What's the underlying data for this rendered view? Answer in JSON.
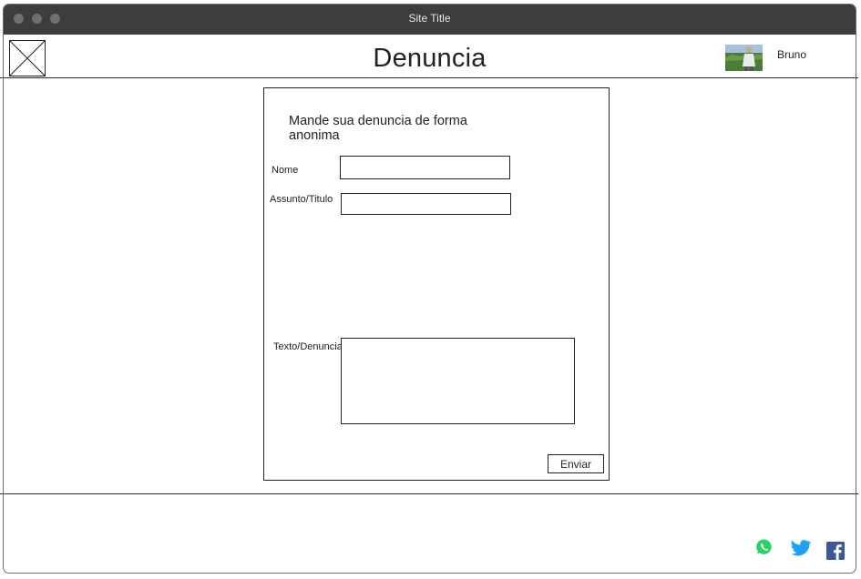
{
  "window": {
    "title": "Site Title"
  },
  "header": {
    "logo_icon": "image-placeholder-icon",
    "page_title": "Denuncia",
    "user": {
      "name": "Bruno",
      "avatar_icon": "user-avatar"
    }
  },
  "form": {
    "heading": "Mande sua denuncia de forma anonima",
    "fields": {
      "nome": {
        "label": "Nome",
        "value": ""
      },
      "assunto": {
        "label": "Assunto/Titulo",
        "value": ""
      },
      "texto": {
        "label": "Texto/Denuncia",
        "value": ""
      }
    },
    "submit_label": "Enviar"
  },
  "footer": {
    "social": [
      {
        "icon": "whatsapp-icon",
        "color": "#25D366"
      },
      {
        "icon": "twitter-icon",
        "color": "#1DA1F2"
      },
      {
        "icon": "facebook-icon",
        "color": "#3B5998"
      }
    ]
  }
}
